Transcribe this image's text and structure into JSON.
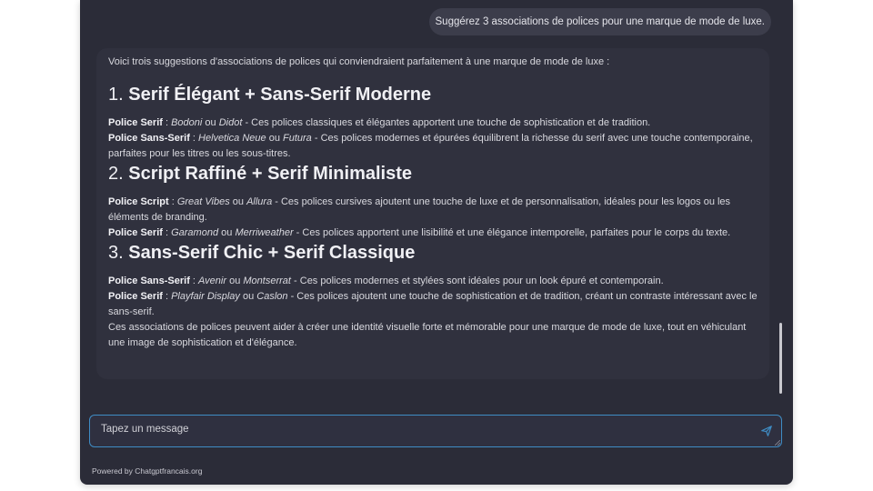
{
  "conversation": {
    "user_message": "Suggérez 3 associations de polices pour une marque de mode de luxe.",
    "bot": {
      "intro": "Voici trois suggestions d'associations de polices qui conviendraient parfaitement à une marque de mode de luxe :",
      "sections": [
        {
          "number": "1.",
          "title": "Serif Élégant + Sans-Serif Moderne",
          "items": [
            {
              "label": "Police Serif",
              "sep": " : ",
              "font1": "Bodoni",
              "or": " ou ",
              "font2": "Didot",
              "desc": " - Ces polices classiques et élégantes apportent une touche de sophistication et de tradition."
            },
            {
              "label": "Police Sans-Serif",
              "sep": " : ",
              "font1": "Helvetica Neue",
              "or": " ou ",
              "font2": "Futura",
              "desc": " - Ces polices modernes et épurées équilibrent la richesse du serif avec une touche contemporaine, parfaites pour les titres ou les sous-titres."
            }
          ]
        },
        {
          "number": "2.",
          "title": "Script Raffiné + Serif Minimaliste",
          "items": [
            {
              "label": "Police Script",
              "sep": " : ",
              "font1": "Great Vibes",
              "or": " ou ",
              "font2": "Allura",
              "desc": " - Ces polices cursives ajoutent une touche de luxe et de personnalisation, idéales pour les logos ou les éléments de branding."
            },
            {
              "label": "Police Serif",
              "sep": " : ",
              "font1": "Garamond",
              "or": " ou ",
              "font2": "Merriweather",
              "desc": " - Ces polices apportent une lisibilité et une élégance intemporelle, parfaites pour le corps du texte."
            }
          ]
        },
        {
          "number": "3.",
          "title": "Sans-Serif Chic + Serif Classique",
          "items": [
            {
              "label": "Police Sans-Serif",
              "sep": " : ",
              "font1": "Avenir",
              "or": " ou ",
              "font2": "Montserrat",
              "desc": " - Ces polices modernes et stylées sont idéales pour un look épuré et contemporain."
            },
            {
              "label": "Police Serif",
              "sep": " : ",
              "font1": "Playfair Display",
              "or": " ou ",
              "font2": "Caslon",
              "desc": " - Ces polices ajoutent une touche de sophistication et de tradition, créant un contraste intéressant avec le sans-serif."
            }
          ]
        }
      ],
      "conclusion": "Ces associations de polices peuvent aider à créer une identité visuelle forte et mémorable pour une marque de mode de luxe, tout en véhiculant une image de sophistication et d'élégance."
    }
  },
  "input": {
    "placeholder": "Tapez un message",
    "value": "",
    "send_icon": "send-icon"
  },
  "footer": {
    "text": "Powered by Chatgptfrancais.org"
  },
  "colors": {
    "panel": "#2b2c38",
    "bubble": "#30313e",
    "user_bubble": "#3c3d4b",
    "input_border": "#3f8cc4",
    "send_icon": "#3f8cc4"
  }
}
